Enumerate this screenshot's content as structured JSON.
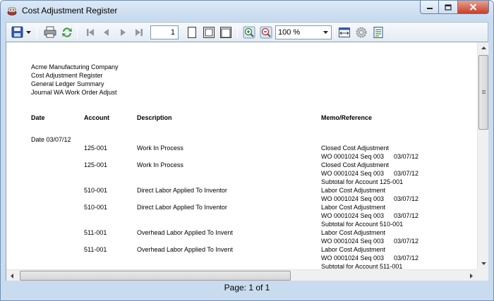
{
  "window": {
    "title": "Cost Adjustment Register"
  },
  "toolbar": {
    "page_number": "1",
    "zoom": "100 %"
  },
  "report": {
    "header_lines": [
      "Acme Manufacturing Company",
      "Cost Adjustment Register",
      "General Ledger Summary",
      "Journal WA Work Order Adjust"
    ],
    "columns": {
      "date": "Date",
      "account": "Account",
      "description": "Description",
      "memo": "Memo/Reference"
    },
    "date_group": "Date 03/07/12",
    "rows": [
      {
        "account": "125-001",
        "description": "Work In Process",
        "memo1": "Closed Cost Adjustment",
        "memo2": "WO 0001024 Seq 003",
        "memo_date": "03/07/12"
      },
      {
        "account": "125-001",
        "description": "Work In Process",
        "memo1": "Closed Cost Adjustment",
        "memo2": "WO 0001024 Seq 003",
        "memo_date": "03/07/12",
        "subtotal": "Subtotal for Account 125-001"
      },
      {
        "account": "510-001",
        "description": "Direct Labor Applied To Inventor",
        "memo1": "Labor Cost Adjustment",
        "memo2": "WO 0001024 Seq 003",
        "memo_date": "03/07/12"
      },
      {
        "account": "510-001",
        "description": "Direct Labor Applied To Inventor",
        "memo1": "Labor Cost Adjustment",
        "memo2": "WO 0001024 Seq 003",
        "memo_date": "03/07/12",
        "subtotal": "Subtotal for Account 510-001"
      },
      {
        "account": "511-001",
        "description": "Overhead Labor Applied To Invent",
        "memo1": "Labor Cost Adjustment",
        "memo2": "WO 0001024 Seq 003",
        "memo_date": "03/07/12"
      },
      {
        "account": "511-001",
        "description": "Overhead Labor Applied To Invent",
        "memo1": "Labor Cost Adjustment",
        "memo2": "WO 0001024 Seq 003",
        "memo_date": "03/07/12",
        "subtotal": "Subtotal for Account 511-001"
      }
    ]
  },
  "status": {
    "page_indicator": "Page: 1 of 1"
  },
  "colors": {
    "window_frame": "#c9dcef",
    "close_button": "#c8402a",
    "paper": "#ffffff"
  }
}
